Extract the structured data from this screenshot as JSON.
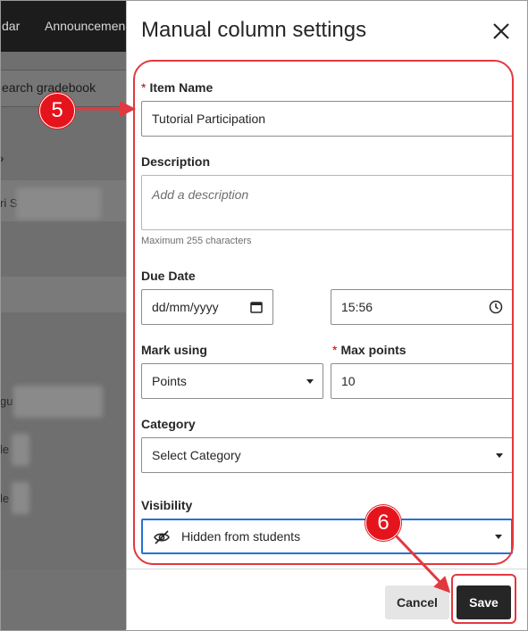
{
  "background": {
    "nav_items": [
      "dar",
      "Announcemen"
    ],
    "search_text": "earch gradebook",
    "row_fragments": [
      "ri S",
      "gu",
      "le",
      "le"
    ]
  },
  "dialog": {
    "title": "Manual column settings",
    "item_name": {
      "label": "Item Name",
      "required_mark": "*",
      "value": "Tutorial Participation"
    },
    "description": {
      "label": "Description",
      "placeholder": "Add a description",
      "hint": "Maximum 255 characters"
    },
    "due_date": {
      "label": "Due Date",
      "date_value": "dd/mm/yyyy",
      "time_value": "15:56"
    },
    "mark_using": {
      "label": "Mark using",
      "value": "Points"
    },
    "max_points": {
      "label": "Max points",
      "required_mark": "*",
      "value": "10"
    },
    "category": {
      "label": "Category",
      "value": "Select Category"
    },
    "visibility": {
      "label": "Visibility",
      "value": "Hidden from students"
    },
    "footer": {
      "cancel_label": "Cancel",
      "save_label": "Save"
    }
  },
  "annotations": {
    "step_a": "5",
    "step_b": "6",
    "color": "#e2383f"
  }
}
